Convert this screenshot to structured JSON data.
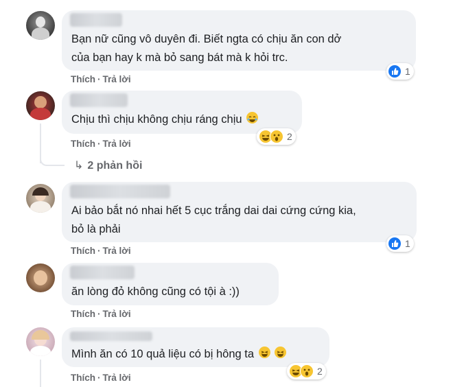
{
  "actions": {
    "like": "Thích",
    "reply": "Trả lời",
    "sep": "·"
  },
  "comments": [
    {
      "lines": [
        "Bạn nữ cũng vô duyên đi. Biết ngta có chịu ăn con dở",
        "của bạn hay k mà bỏ sang bát mà k hỏi trc."
      ],
      "reaction_count": "1"
    },
    {
      "lines": [
        "Chịu thì chịu không chịu ráng chịu"
      ],
      "reaction_count": "2",
      "replies_label": "2 phản hồi"
    },
    {
      "lines": [
        "Ai bảo bắt nó nhai hết 5 cục trắng dai dai cứng cứng kia,",
        "bỏ là phải"
      ],
      "reaction_count": "1"
    },
    {
      "lines": [
        "ăn lòng đỏ không cũng có tội à :))"
      ]
    },
    {
      "lines": [
        "Mình ăn có 10 quả liệu có bị hông ta"
      ],
      "reaction_count": "2"
    }
  ],
  "colors": {
    "bubble": "#f0f2f5",
    "like_blue": "#1877f2",
    "emoji_yellow": "#f7c531",
    "meta_gray": "#65676b"
  }
}
